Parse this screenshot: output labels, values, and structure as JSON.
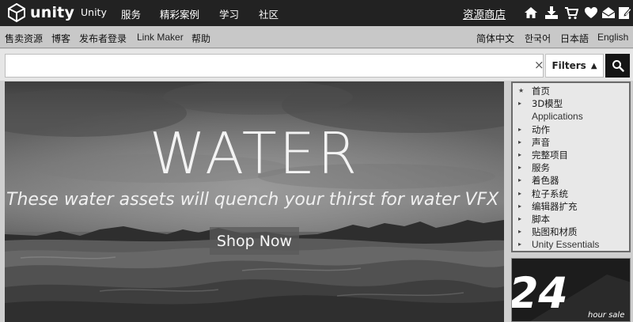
{
  "header": {
    "brand": "unity",
    "nav": [
      "Unity",
      "服务",
      "精彩案例",
      "学习",
      "社区"
    ],
    "store_link": "资源商店",
    "icons": [
      "home-icon",
      "download-icon",
      "cart-icon",
      "heart-icon",
      "mail-icon",
      "edit-icon"
    ]
  },
  "subnav": {
    "left": [
      "售卖资源",
      "博客",
      "发布者登录",
      "Link Maker",
      "帮助"
    ],
    "languages": [
      "简体中文",
      "한국어",
      "日本語",
      "English"
    ]
  },
  "search": {
    "value": "",
    "placeholder": "",
    "clear": "×",
    "filters_label": "Filters",
    "filters_arrow": "▲",
    "button_icon": "search-icon"
  },
  "hero": {
    "title": "WATER",
    "subtitle": "These water assets will quench your thirst for water VFX",
    "cta": "Shop Now"
  },
  "categories": [
    {
      "label": "首页",
      "marker": "★"
    },
    {
      "label": "3D模型",
      "marker": "▸"
    },
    {
      "label": "Applications",
      "marker": ""
    },
    {
      "label": "动作",
      "marker": "▸"
    },
    {
      "label": "声音",
      "marker": "▸"
    },
    {
      "label": "完整项目",
      "marker": "▸"
    },
    {
      "label": "服务",
      "marker": "▸"
    },
    {
      "label": "着色器",
      "marker": "▸"
    },
    {
      "label": "粒子系统",
      "marker": "▸"
    },
    {
      "label": "编辑器扩充",
      "marker": "▸"
    },
    {
      "label": "脚本",
      "marker": "▸"
    },
    {
      "label": "贴图和材质",
      "marker": "▸"
    },
    {
      "label": "Unity Essentials",
      "marker": "▸"
    }
  ],
  "sale_banner": {
    "number": "24",
    "caption": "hour sale"
  }
}
